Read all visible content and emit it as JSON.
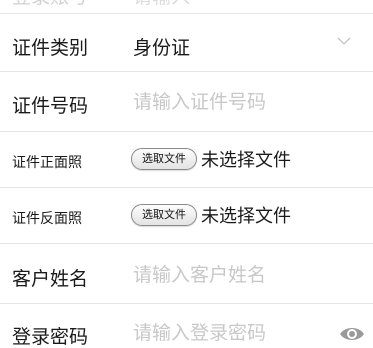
{
  "form": {
    "clipped_row": {
      "label": "登录账号",
      "value": "请输入"
    },
    "id_type": {
      "label": "证件类别",
      "value": "身份证",
      "chevron_icon": "chevron-down-icon"
    },
    "id_number": {
      "label": "证件号码",
      "placeholder": "请输入证件号码"
    },
    "id_front": {
      "label": "证件正面照",
      "button_label": "选取文件",
      "status": "未选择文件"
    },
    "id_back": {
      "label": "证件反面照",
      "button_label": "选取文件",
      "status": "未选择文件"
    },
    "customer_name": {
      "label": "客户姓名",
      "placeholder": "请输入客户姓名"
    },
    "login_password": {
      "label": "登录密码",
      "placeholder": "请输入登录密码",
      "toggle_icon": "eye-icon"
    }
  },
  "colors": {
    "text": "#1a1a1a",
    "placeholder": "#c8c8c8",
    "divider": "#e4e4e4",
    "icon": "#9a9a9a"
  }
}
